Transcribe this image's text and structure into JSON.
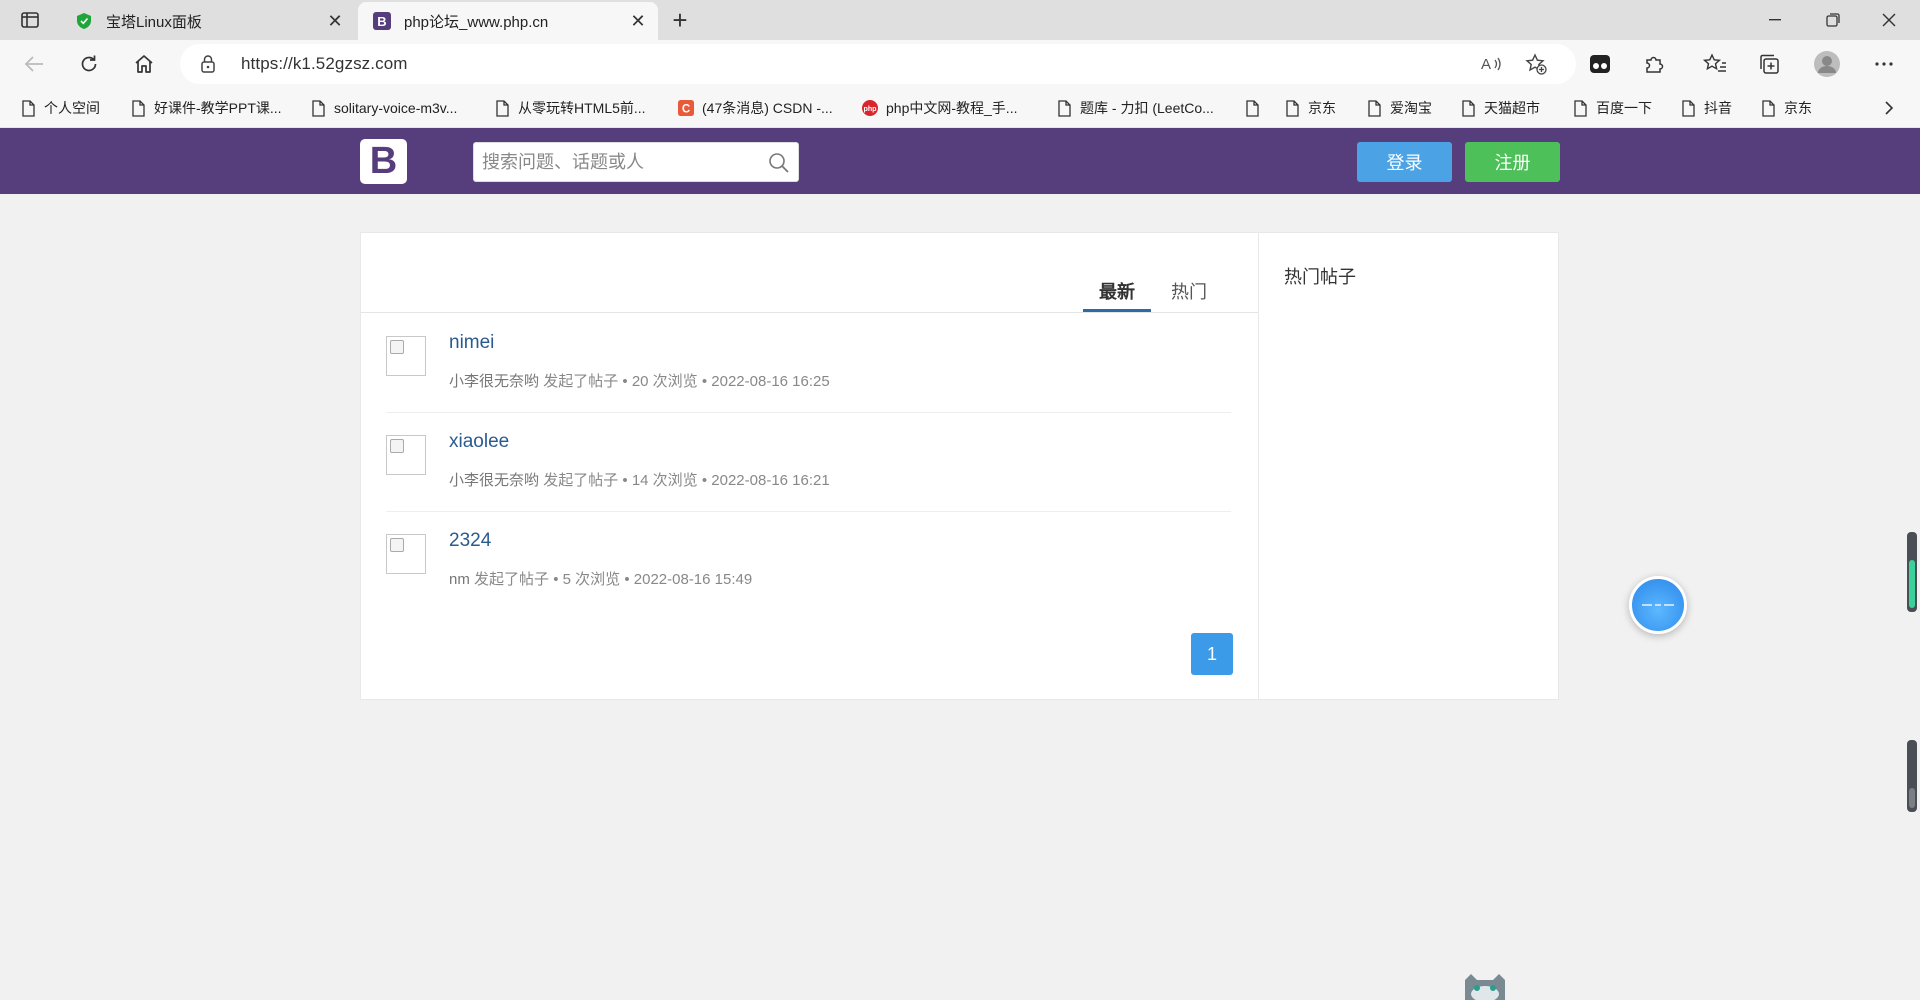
{
  "browser": {
    "tabs": [
      {
        "title": "宝塔Linux面板",
        "active": false
      },
      {
        "title": "php论坛_www.php.cn",
        "active": true
      }
    ],
    "url": "https://k1.52gzsz.com",
    "bookmarks": [
      "个人空间",
      "好课件-教学PPT课...",
      "solitary-voice-m3v...",
      "从零玩转HTML5前...",
      "(47条消息) CSDN -...",
      "php中文网-教程_手...",
      "题库 - 力扣 (LeetCo...",
      "",
      "京东",
      "爱淘宝",
      "天猫超市",
      "百度一下",
      "抖音",
      "京东"
    ]
  },
  "header": {
    "logo_letter": "B",
    "search_placeholder": "搜索问题、话题或人",
    "login_label": "登录",
    "register_label": "注册"
  },
  "main": {
    "tabs": [
      {
        "label": "最新",
        "active": true
      },
      {
        "label": "热门",
        "active": false
      }
    ],
    "posts": [
      {
        "title": "nimei",
        "author": "小李很无奈哟",
        "action": "发起了帖子",
        "views": "20 次浏览",
        "time": "2022-08-16 16:25"
      },
      {
        "title": "xiaolee",
        "author": "小李很无奈哟",
        "action": "发起了帖子",
        "views": "14 次浏览",
        "time": "2022-08-16 16:21"
      },
      {
        "title": "2324",
        "author": "nm",
        "action": "发起了帖子",
        "views": "5 次浏览",
        "time": "2022-08-16 15:49"
      }
    ],
    "pagination": {
      "current_page": "1"
    }
  },
  "sidebar": {
    "title": "热门帖子"
  },
  "colors": {
    "header_bg": "#563d7c",
    "login_btn": "#4ba3e6",
    "register_btn": "#4ec05a",
    "link": "#2a5b8f",
    "pager": "#3b9be8"
  },
  "icons": {
    "search": "search-icon",
    "lock": "lock-icon",
    "refresh": "refresh-icon",
    "home": "home-icon",
    "back": "back-arrow-icon",
    "close_tab": "close-icon",
    "new_tab": "plus-icon"
  }
}
